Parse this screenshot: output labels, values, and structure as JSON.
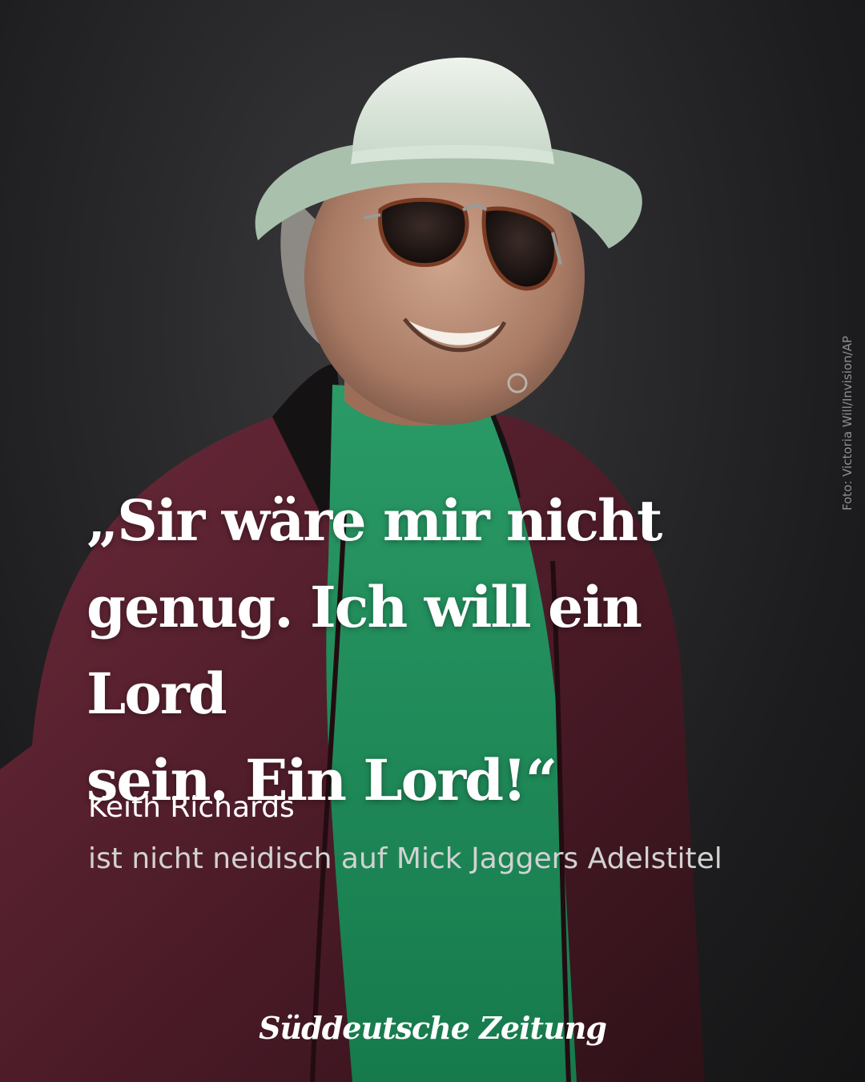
{
  "photo": {
    "credit": "Foto: Victoria Will/Invision/AP",
    "colors": {
      "background": "#1e1e20",
      "jacket": "#5a1f2e",
      "shirt": "#1f8a5a",
      "hat": "#dfe9df"
    }
  },
  "quote": {
    "line1": "„Sir wäre mir  nicht",
    "line2": "genug. Ich will ein Lord",
    "line3": "sein. Ein Lord!“"
  },
  "attribution": {
    "speaker": "Keith Richards",
    "context": "ist nicht neidisch auf Mick Jaggers Adelstitel"
  },
  "brand": {
    "logo_text": "Süddeutsche Zeitung"
  }
}
